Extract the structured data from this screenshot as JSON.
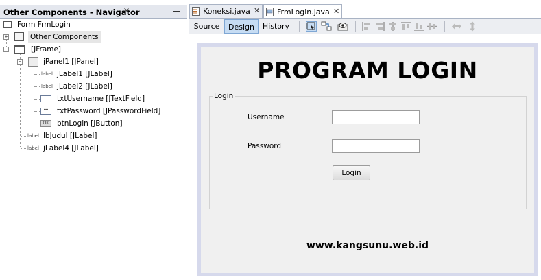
{
  "navigator": {
    "title": "Other Components - Navigator",
    "close_glyph": "✕",
    "tree": {
      "root": "Form FrmLogin",
      "other_components": "Other Components",
      "jframe": "[JFrame]",
      "jpanel1": "jPanel1 [JPanel]",
      "jlabel1": "jLabel1 [JLabel]",
      "jlabel2": "jLabel2 [JLabel]",
      "txtusername": "txtUsername [JTextField]",
      "txtpassword": "txtPassword [JPasswordField]",
      "btnlogin": "btnLogin [JButton]",
      "lbjudul": "lbJudul [JLabel]",
      "jlabel4": "jLabel4 [JLabel]",
      "label_icon_text": "label",
      "button_icon_text": "OK",
      "password_icon_text": "•••"
    }
  },
  "editor": {
    "tabs": [
      {
        "label": "Koneksi.java",
        "close": "✕"
      },
      {
        "label": "FrmLogin.java",
        "close": "✕"
      }
    ],
    "view_tabs": {
      "source": "Source",
      "design": "Design",
      "history": "History"
    },
    "icons": [
      "selection-mode-icon",
      "connection-mode-icon",
      "preview-design-icon",
      "align-left-icon",
      "align-right-icon",
      "center-horizontal-icon",
      "align-top-icon",
      "align-bottom-icon",
      "center-vertical-icon",
      "resize-horizontal-icon",
      "resize-vertical-icon"
    ]
  },
  "form": {
    "title": "PROGRAM LOGIN",
    "group_label": "Login",
    "username_label": "Username",
    "password_label": "Password",
    "username_value": "",
    "password_value": "",
    "login_button": "Login",
    "footer": "www.kangsunu.web.id"
  },
  "colors": {
    "canvas_border": "#d6d9ec",
    "form_background": "#f0f0f0",
    "design_tab_active": "#c6dcf3"
  }
}
